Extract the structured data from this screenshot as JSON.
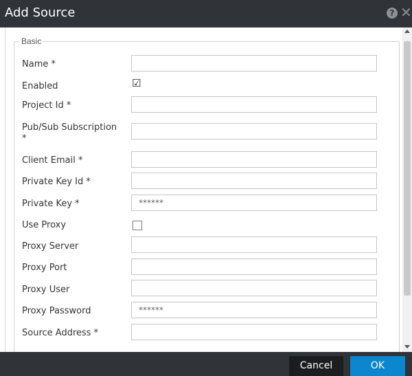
{
  "dialog": {
    "title": "Add Source",
    "help_icon_glyph": "?",
    "close_icon_glyph": "✕"
  },
  "form": {
    "section_legend": "Basic",
    "fields": {
      "name": {
        "label": "Name *",
        "value": ""
      },
      "enabled": {
        "label": "Enabled",
        "checked": true
      },
      "project_id": {
        "label": "Project Id *",
        "value": ""
      },
      "pubsub_subscription": {
        "label_line1": "Pub/Sub Subscription",
        "label_line2": "*",
        "value": ""
      },
      "client_email": {
        "label": "Client Email *",
        "value": ""
      },
      "private_key_id": {
        "label": "Private Key Id *",
        "value": ""
      },
      "private_key": {
        "label": "Private Key *",
        "value": "******"
      },
      "use_proxy": {
        "label": "Use Proxy",
        "checked": false
      },
      "proxy_server": {
        "label": "Proxy Server",
        "value": ""
      },
      "proxy_port": {
        "label": "Proxy Port",
        "value": ""
      },
      "proxy_user": {
        "label": "Proxy User",
        "value": ""
      },
      "proxy_password": {
        "label": "Proxy Password",
        "value": "******"
      },
      "source_address": {
        "label": "Source Address *",
        "value": ""
      }
    }
  },
  "footer": {
    "cancel_label": "Cancel",
    "ok_label": "OK"
  },
  "colors": {
    "titlebar": "#303337",
    "ok_button": "#0b86cf",
    "cancel_button": "#1b1d20"
  }
}
